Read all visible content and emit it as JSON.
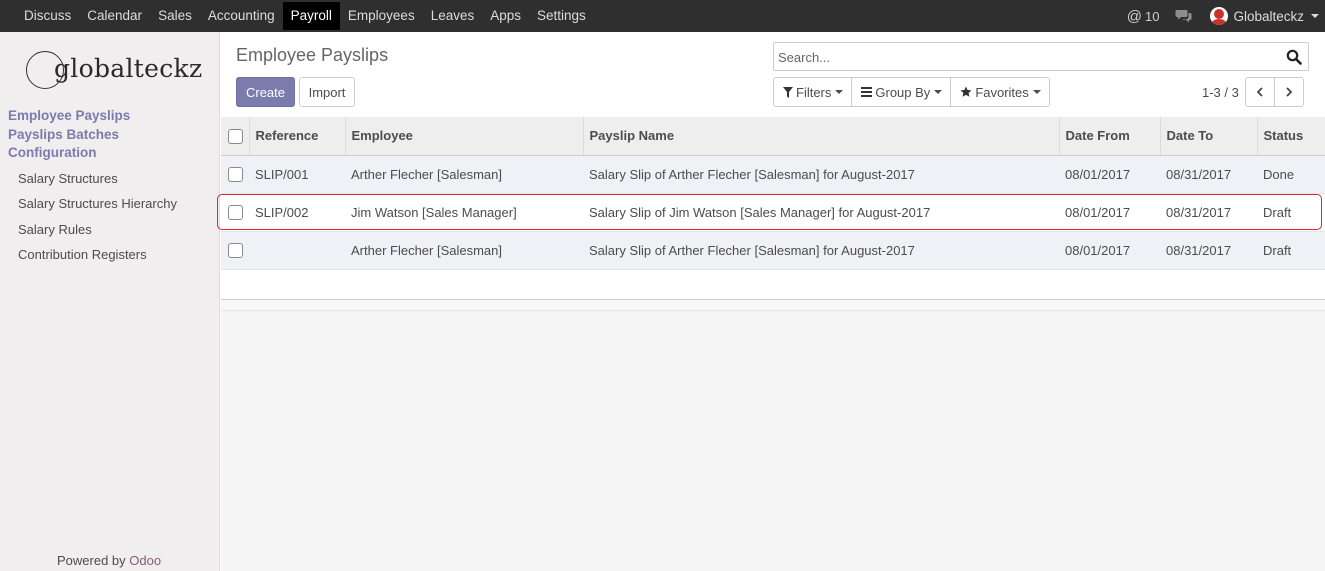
{
  "topbar": {
    "menu": [
      "Discuss",
      "Calendar",
      "Sales",
      "Accounting",
      "Payroll",
      "Employees",
      "Leaves",
      "Apps",
      "Settings"
    ],
    "active_menu": "Payroll",
    "messages_count": "10",
    "user_name": "Globalteckz"
  },
  "sidebar": {
    "logo_text": "globalteckz",
    "sections": [
      "Employee Payslips",
      "Payslips Batches",
      "Configuration"
    ],
    "items": [
      "Salary Structures",
      "Salary Structures Hierarchy",
      "Salary Rules",
      "Contribution Registers"
    ],
    "powered_by": "Powered by",
    "powered_brand": "Odoo"
  },
  "control_panel": {
    "title": "Employee Payslips",
    "create_label": "Create",
    "import_label": "Import",
    "search_placeholder": "Search...",
    "filters_label": "Filters",
    "groupby_label": "Group By",
    "favorites_label": "Favorites",
    "pager_value": "1-3 / 3"
  },
  "table": {
    "columns": [
      "Reference",
      "Employee",
      "Payslip Name",
      "Date From",
      "Date To",
      "Status"
    ],
    "rows": [
      {
        "reference": "SLIP/001",
        "employee": "Arther Flecher [Salesman]",
        "name": "Salary Slip of Arther Flecher [Salesman] for August-2017",
        "date_from": "08/01/2017",
        "date_to": "08/31/2017",
        "status": "Done"
      },
      {
        "reference": "SLIP/002",
        "employee": "Jim Watson [Sales Manager]",
        "name": "Salary Slip of Jim Watson [Sales Manager] for August-2017",
        "date_from": "08/01/2017",
        "date_to": "08/31/2017",
        "status": "Draft"
      },
      {
        "reference": "",
        "employee": "Arther Flecher [Salesman]",
        "name": "Salary Slip of Arther Flecher [Salesman] for August-2017",
        "date_from": "08/01/2017",
        "date_to": "08/31/2017",
        "status": "Draft"
      }
    ]
  },
  "colors": {
    "topbar_bg": "#2f2f2f",
    "primary": "#7c7bad",
    "highlight": "#e0272c",
    "brand_odoo": "#875a7b"
  }
}
